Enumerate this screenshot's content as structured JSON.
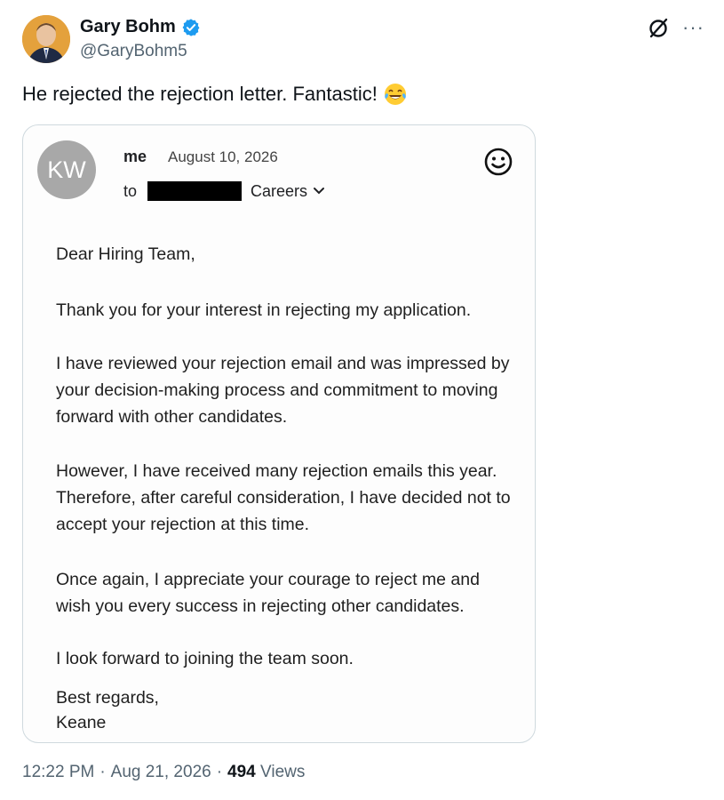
{
  "author": {
    "display_name": "Gary Bohm",
    "handle": "@GaryBohm5"
  },
  "tweet": {
    "text": "He rejected the rejection letter. Fantastic!",
    "emoji": "face-with-tears-of-joy"
  },
  "email": {
    "avatar_initials": "KW",
    "from": "me",
    "date": "August 10, 2026",
    "to_label": "to",
    "recipient": "Careers",
    "greeting": "Dear Hiring Team,",
    "paragraphs": [
      "Thank you for your interest in rejecting my application.",
      "I have reviewed your rejection email and was impressed by your decision-making process and commitment to moving forward with other candidates.",
      "However, I have received many rejection emails this year. Therefore, after careful consideration, I have decided not to accept your rejection at this time.",
      "Once again, I appreciate your courage to reject me and wish you every success in rejecting other candidates.",
      "I look forward to joining the team soon."
    ],
    "signoff": "Best regards,",
    "signature": "Keane"
  },
  "meta": {
    "time": "12:22 PM",
    "separator": "·",
    "date": "Aug 21, 2026",
    "views_count": "494",
    "views_label": "Views"
  },
  "colors": {
    "verified": "#1d9bf0",
    "secondary_text": "#536471",
    "border": "#cfd9de"
  }
}
